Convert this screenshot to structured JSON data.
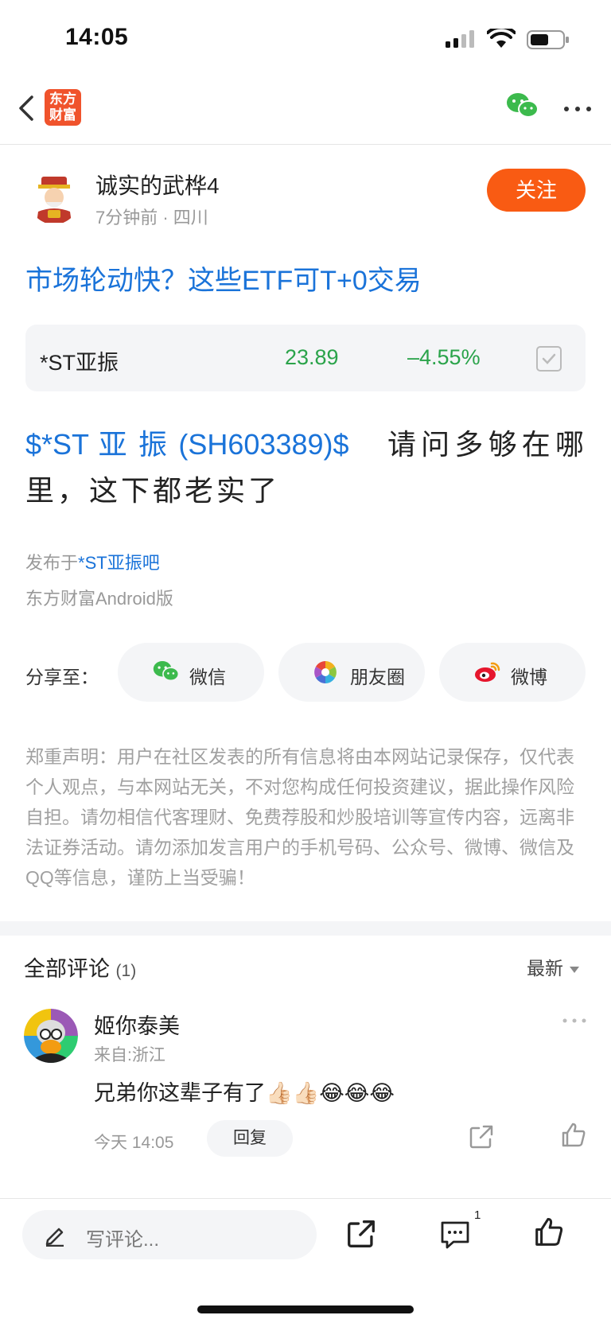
{
  "status_bar": {
    "time": "14:05"
  },
  "nav": {
    "logo_text_1": "东方",
    "logo_text_2": "财富"
  },
  "author": {
    "name": "诚实的武桦4",
    "meta": "7分钟前 · 四川",
    "follow_label": "关注"
  },
  "post": {
    "title": "市场轮动快？这些ETF可T+0交易",
    "stock": {
      "name": "*ST亚振",
      "price": "23.89",
      "change": "–4.55%",
      "colors": {
        "down": "#2aa34a"
      }
    },
    "content_link": "$*ST 亚 振 (SH603389)$",
    "content_text": "请问多够在哪里，这下都老实了",
    "published_prefix": "发布于",
    "published_bar": "*ST亚振吧",
    "device": "东方财富Android版"
  },
  "share": {
    "label": "分享至：",
    "buttons": [
      {
        "label": "微信"
      },
      {
        "label": "朋友圈"
      },
      {
        "label": "微博"
      }
    ]
  },
  "disclaimer": "郑重声明：用户在社区发表的所有信息将由本网站记录保存，仅代表个人观点，与本网站无关，不对您构成任何投资建议，据此操作风险自担。请勿相信代客理财、免费荐股和炒股培训等宣传内容，远离非法证券活动。请勿添加发言用户的手机号码、公众号、微博、微信及QQ等信息，谨防上当受骗！",
  "comments_header": {
    "title": "全部评论",
    "count": "(1)",
    "sort": "最新"
  },
  "comments": [
    {
      "name": "姬你泰美",
      "from": "来自:浙江",
      "text": "兄弟你这辈子有了👍🏻👍🏻😂😂😂",
      "time": "今天 14:05",
      "reply_label": "回复"
    }
  ],
  "bottom_bar": {
    "placeholder": "写评论...",
    "comment_count": "1"
  },
  "colors": {
    "accent_blue": "#1a73d9",
    "follow_orange": "#f95b13",
    "brand_orange": "#f0532c"
  }
}
